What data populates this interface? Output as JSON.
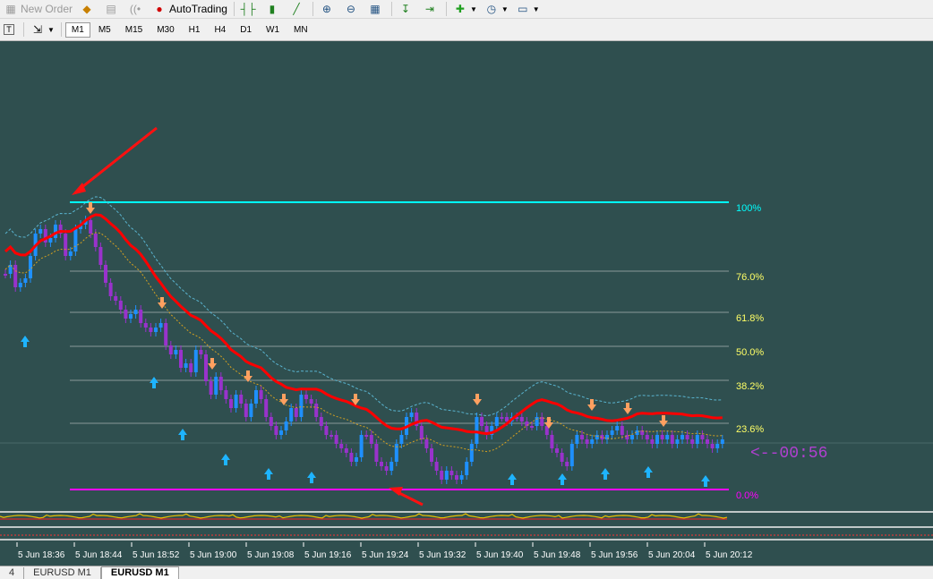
{
  "toolbar": {
    "new_order_label": "New Order",
    "auto_trading_label": "AutoTrading"
  },
  "timeframes": [
    "M1",
    "M5",
    "M15",
    "M30",
    "H1",
    "H4",
    "D1",
    "W1",
    "MN"
  ],
  "active_timeframe": "M1",
  "chart_data": {
    "type": "candlestick",
    "symbol": "EURUSD",
    "timeframe": "M1",
    "time_labels": [
      "5 Jun 18:36",
      "5 Jun 18:44",
      "5 Jun 18:52",
      "5 Jun 19:00",
      "5 Jun 19:08",
      "5 Jun 19:16",
      "5 Jun 19:24",
      "5 Jun 19:32",
      "5 Jun 19:40",
      "5 Jun 19:48",
      "5 Jun 19:56",
      "5 Jun 20:04",
      "5 Jun 20:12"
    ],
    "fib_levels": [
      {
        "label": "100%",
        "color": "#00ffff"
      },
      {
        "label": "76.0%",
        "color": "#ffff66"
      },
      {
        "label": "61.8%",
        "color": "#ffff66"
      },
      {
        "label": "50.0%",
        "color": "#ffff66"
      },
      {
        "label": "38.2%",
        "color": "#ffff66"
      },
      {
        "label": "23.6%",
        "color": "#ffff66"
      },
      {
        "label": "0.0%",
        "color": "#ff00ff"
      }
    ],
    "countdown": "<--00:56",
    "colors": {
      "background": "#2f4f4f",
      "bull": "#1e90ff",
      "bear": "#9932cc",
      "ma": "#ff0000",
      "up_arrow": "#1eb4ff",
      "down_arrow": "#ffa060"
    }
  },
  "tabs": [
    "4",
    "EURUSD M1",
    "EURUSD M1"
  ],
  "active_tab": 2
}
